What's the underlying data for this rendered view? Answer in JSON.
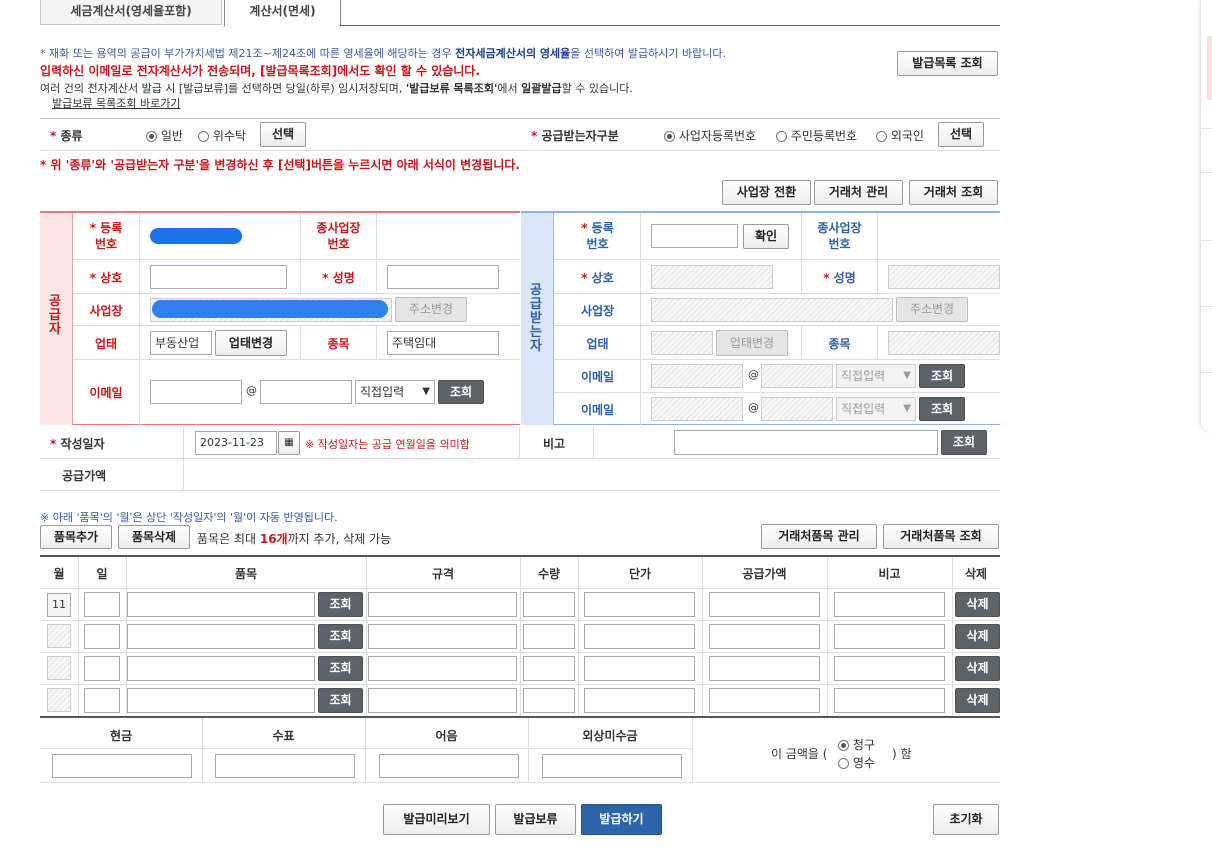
{
  "tabs": [
    "세금계산서(영세율포함)",
    "계산서(면세)"
  ],
  "notice": {
    "line1_pre": "* 재화 또는 용역의 공급이 부가가치세법 제21조~제24조에 따른 영세율에 해당하는 경우 ",
    "line1_bold": "전자세금계산서의 영세율",
    "line1_post": "을 선택하여 발급하시기 바랍니다.",
    "line2": "입력하신 이메일로 전자계산서가 전송되며, [발급목록조회]에서도 확인 할 수 있습니다.",
    "line3_pre": "여러 건의 전자계산서 발급 시 [발급보류]를 선택하면 당일(하루) 임시저장되며, ",
    "line3_bold1": "'발급보류 목록조회'",
    "line3_mid": "에서 ",
    "line3_bold2": "일괄발급",
    "line3_post": "할 수 있습니다.",
    "link": "발급보류 목록조회 바로가기",
    "list_button": "발급목록 조회"
  },
  "kind": {
    "label": "종류",
    "options": [
      "일반",
      "위수탁"
    ],
    "select_button": "선택",
    "recv_label": "공급받는자구분",
    "recv_options": [
      "사업자등록번호",
      "주민등록번호",
      "외국인"
    ],
    "recv_select_button": "선택",
    "warning": "* 위 '종류'와 '공급받는자 구분'을 변경하신 후 [선택]버튼을 누르시면 아래 서식이 변경됩니다."
  },
  "top_buttons": [
    "사업장 전환",
    "거래처 관리",
    "거래처 조회"
  ],
  "supplier": {
    "side": "공급자",
    "reg_label": "등록\n번호",
    "sub_label": "종사업장\n번호",
    "name_label": "상호",
    "ceo_label": "성명",
    "addr_label": "사업장",
    "addr_button": "주소변경",
    "biz_label": "업태",
    "biz_value": "부동산업",
    "biz_button": "업태변경",
    "item_label": "종목",
    "item_value": "주택임대",
    "email_label": "이메일",
    "at": "@",
    "email_select": "직접입력",
    "lookup": "조회"
  },
  "receiver": {
    "side": "공급받는자",
    "reg_label": "등록\n번호",
    "confirm": "확인",
    "sub_label": "종사업장\n번호",
    "name_label": "상호",
    "ceo_label": "성명",
    "addr_label": "사업장",
    "addr_button": "주소변경",
    "biz_label": "업태",
    "biz_button": "업태변경",
    "item_label": "종목",
    "email_label": "이메일",
    "at": "@",
    "email_select": "직접입력",
    "lookup": "조회"
  },
  "date": {
    "label": "작성일자",
    "value": "2023-11-23",
    "note": "※ 작성일자는 공급 연월일을 의미함",
    "memo_label": "비고",
    "lookup": "조회",
    "amount_label": "공급가액"
  },
  "items": {
    "note": "※ 아래 '품목'의 '월'은 상단 '작성일자'의 '월'이 자동 반영됩니다.",
    "add": "품목추가",
    "del": "품목삭제",
    "limit_pre": "품목은 최대 ",
    "limit_num": "16개",
    "limit_post": "까지 추가, 삭제 가능",
    "manage": "거래처품목 관리",
    "lookup": "거래처품목 조회",
    "headers": [
      "월",
      "일",
      "품목",
      "규격",
      "수량",
      "단가",
      "공급가액",
      "비고",
      "삭제"
    ],
    "first_month": "11",
    "row_lookup": "조회",
    "row_delete": "삭제"
  },
  "payment": {
    "headers": [
      "현금",
      "수표",
      "어음",
      "외상미수금"
    ],
    "text_pre": "이 금액을 (",
    "opt1": "청구",
    "opt2": "영수",
    "text_post": ") 함"
  },
  "bottom_buttons": [
    "발급미리보기",
    "발급보류",
    "발급하기"
  ],
  "reset": "초기화"
}
